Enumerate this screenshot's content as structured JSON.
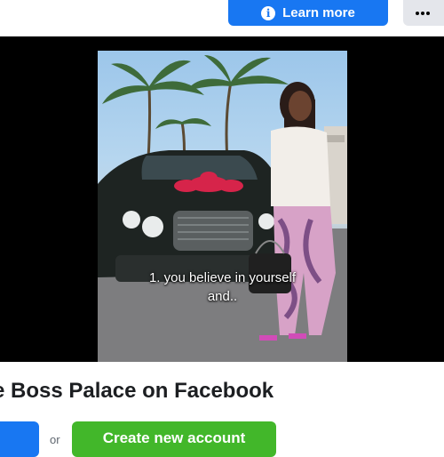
{
  "header": {
    "learn_more_label": "Learn more",
    "info_icon": "i",
    "more_icon": "more-horizontal-icon"
  },
  "video": {
    "caption_line1": "1. you believe in yourself",
    "caption_line2": "and.."
  },
  "page": {
    "heading": "e Boss Palace on Facebook"
  },
  "actions": {
    "or_label": "or",
    "create_account_label": "Create new account"
  },
  "colors": {
    "primary_blue": "#1877f2",
    "green": "#42b72a",
    "gray_button": "#e4e6eb"
  }
}
